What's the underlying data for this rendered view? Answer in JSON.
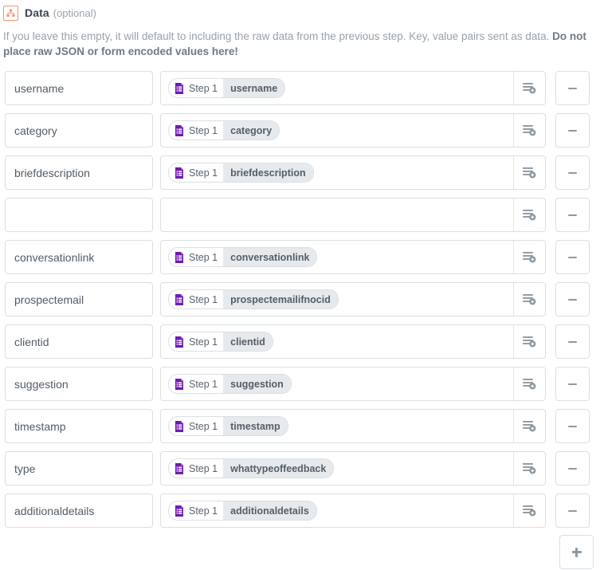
{
  "field": {
    "icon": "sitemap-icon",
    "icon_color": "#f09472",
    "title": "Data",
    "optional_label": "(optional)",
    "help_text_normal": "If you leave this empty, it will default to including the raw data from the previous step. Key, value pairs sent as data. ",
    "help_text_bold": "Do not place raw JSON or form encoded values here!"
  },
  "controls": {
    "insert_icon": "insert-list-plus-icon",
    "remove_icon": "minus-icon",
    "add_icon": "plus-icon",
    "key_placeholder": "",
    "value_placeholder": ""
  },
  "token_style": {
    "app_icon": "google-forms-icon",
    "app_icon_color": "#6f1ab1",
    "chip_field_bg": "#e7eaec"
  },
  "rows": [
    {
      "key": "username",
      "token_step": "Step 1",
      "token_field": "username",
      "has_token": true
    },
    {
      "key": "category",
      "token_step": "Step 1",
      "token_field": "category",
      "has_token": true
    },
    {
      "key": "briefdescription",
      "token_step": "Step 1",
      "token_field": "briefdescription",
      "has_token": true
    },
    {
      "key": "",
      "token_step": "",
      "token_field": "",
      "has_token": false
    },
    {
      "key": "conversationlink",
      "token_step": "Step 1",
      "token_field": "conversationlink",
      "has_token": true
    },
    {
      "key": "prospectemail",
      "token_step": "Step 1",
      "token_field": "prospectemailifnocid",
      "has_token": true
    },
    {
      "key": "clientid",
      "token_step": "Step 1",
      "token_field": "clientid",
      "has_token": true
    },
    {
      "key": "suggestion",
      "token_step": "Step 1",
      "token_field": "suggestion",
      "has_token": true
    },
    {
      "key": "timestamp",
      "token_step": "Step 1",
      "token_field": "timestamp",
      "has_token": true
    },
    {
      "key": "type",
      "token_step": "Step 1",
      "token_field": "whattypeoffeedback",
      "has_token": true
    },
    {
      "key": "additionaldetails",
      "token_step": "Step 1",
      "token_field": "additionaldetails",
      "has_token": true
    }
  ]
}
